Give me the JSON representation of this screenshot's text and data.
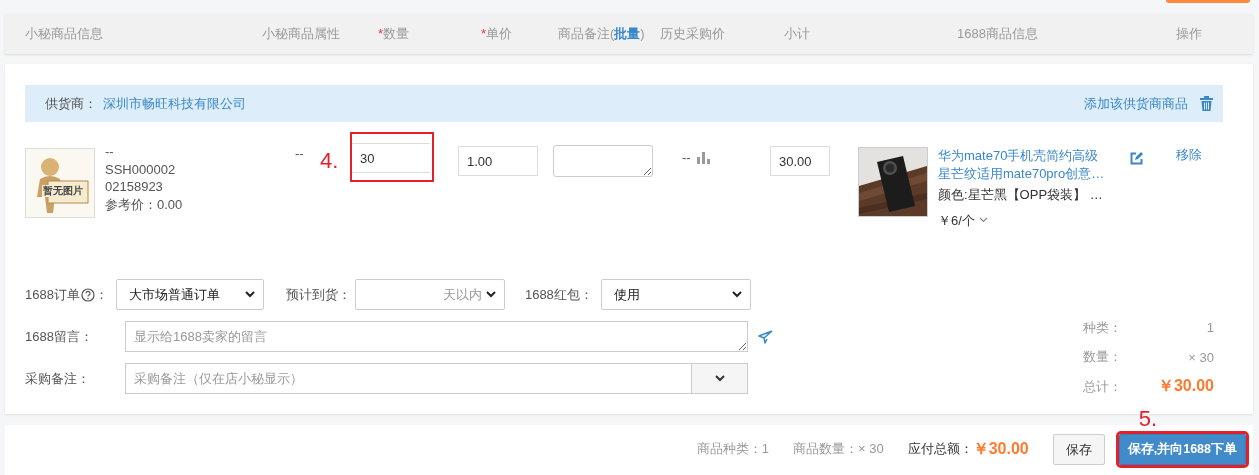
{
  "header": {
    "columns": [
      {
        "label": "小秘商品信息"
      },
      {
        "label": "小秘商品属性"
      },
      {
        "label": "数量",
        "required_mark": "*"
      },
      {
        "label": "单价",
        "required_mark": "*"
      },
      {
        "label": "商品备注(",
        "link": "批量",
        "after": ")"
      },
      {
        "label": "历史采购价"
      },
      {
        "label": "小计"
      },
      {
        "label": "1688商品信息"
      },
      {
        "label": "操作"
      }
    ]
  },
  "supplier": {
    "label": "供货商：",
    "name": "深圳市畅旺科技有限公司",
    "add_link": "添加该供货商商品"
  },
  "item": {
    "image_placeholder": "暂无图片",
    "name": "--",
    "sku": "SSH000002",
    "code": "02158923",
    "ref_price": "参考价：0.00",
    "attribute": "--",
    "quantity": {
      "value": "30",
      "annotation": "4.",
      "highlighted": true
    },
    "price": "1.00",
    "history": "--",
    "subtotal": "30.00",
    "product": {
      "title": "华为mate70手机壳简约高级星芒纹适用mate70pro创意…",
      "variant": "颜色:星芒黑【OPP袋装】 …",
      "unit_price": "￥6/个"
    },
    "remove": "移除"
  },
  "options": [
    {
      "kind": "selects",
      "fields": [
        {
          "label": "1688订单",
          "help": true,
          "colon": "：",
          "value": "大市场普通订单"
        },
        {
          "label": "预计到货：",
          "help": false,
          "suffix": "天以内"
        },
        {
          "label": "1688红包：",
          "help": false,
          "value": "使用"
        }
      ]
    },
    {
      "kind": "message",
      "label": "1688留言：",
      "placeholder": "显示给1688卖家的留言"
    },
    {
      "kind": "remark",
      "label": "采购备注：",
      "placeholder": "采购备注（仅在店小秘显示）"
    }
  ],
  "summary": [
    {
      "label": "种类：",
      "value": "1",
      "emphasis": false
    },
    {
      "label": "数量：",
      "value": "× 30",
      "emphasis": false
    },
    {
      "label": "总计：",
      "value": "￥30.00",
      "emphasis": true
    }
  ],
  "footer": {
    "stats": [
      {
        "label": "商品种类：",
        "value": "1"
      },
      {
        "label": "商品数量：",
        "value": "× 30"
      }
    ],
    "total_label": "应付总额：",
    "total": "￥30.00",
    "buttons": [
      {
        "label": "保存",
        "primary": false,
        "highlighted": false
      },
      {
        "label": "保存,并向1688下单",
        "primary": true,
        "highlighted": true,
        "annotation": "5."
      }
    ]
  }
}
